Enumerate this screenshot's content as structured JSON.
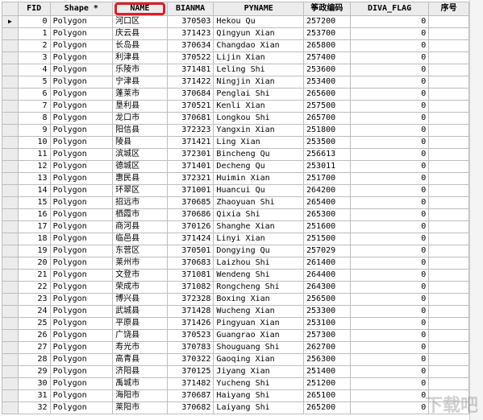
{
  "columns": [
    "FID",
    "Shape *",
    "NAME",
    "BIANMA",
    "PYNAME",
    "筝政编码",
    "DIVA_FLAG",
    "序号"
  ],
  "rows": [
    {
      "fid": "0",
      "shape": "Polygon",
      "name": "河口区",
      "bianma": "370503",
      "pyname": "Hekou Qu",
      "code": "257200",
      "flag": "0"
    },
    {
      "fid": "1",
      "shape": "Polygon",
      "name": "庆云县",
      "bianma": "371423",
      "pyname": "Qingyun Xian",
      "code": "253700",
      "flag": "0"
    },
    {
      "fid": "2",
      "shape": "Polygon",
      "name": "长岛县",
      "bianma": "370634",
      "pyname": "Changdao Xian",
      "code": "265800",
      "flag": "0"
    },
    {
      "fid": "3",
      "shape": "Polygon",
      "name": "利津县",
      "bianma": "370522",
      "pyname": "Lijin Xian",
      "code": "257400",
      "flag": "0"
    },
    {
      "fid": "4",
      "shape": "Polygon",
      "name": "乐陵市",
      "bianma": "371481",
      "pyname": "Leling Shi",
      "code": "253600",
      "flag": "0"
    },
    {
      "fid": "5",
      "shape": "Polygon",
      "name": "宁津县",
      "bianma": "371422",
      "pyname": "Ningjin Xian",
      "code": "253400",
      "flag": "0"
    },
    {
      "fid": "6",
      "shape": "Polygon",
      "name": "蓬莱市",
      "bianma": "370684",
      "pyname": "Penglai Shi",
      "code": "265600",
      "flag": "0"
    },
    {
      "fid": "7",
      "shape": "Polygon",
      "name": "垦利县",
      "bianma": "370521",
      "pyname": "Kenli Xian",
      "code": "257500",
      "flag": "0"
    },
    {
      "fid": "8",
      "shape": "Polygon",
      "name": "龙口市",
      "bianma": "370681",
      "pyname": "Longkou Shi",
      "code": "265700",
      "flag": "0"
    },
    {
      "fid": "9",
      "shape": "Polygon",
      "name": "阳信县",
      "bianma": "372323",
      "pyname": "Yangxin Xian",
      "code": "251800",
      "flag": "0"
    },
    {
      "fid": "10",
      "shape": "Polygon",
      "name": "陵县",
      "bianma": "371421",
      "pyname": "Ling Xian",
      "code": "253500",
      "flag": "0"
    },
    {
      "fid": "11",
      "shape": "Polygon",
      "name": "滨城区",
      "bianma": "372301",
      "pyname": "Bincheng Qu",
      "code": "256613",
      "flag": "0"
    },
    {
      "fid": "12",
      "shape": "Polygon",
      "name": "德城区",
      "bianma": "371401",
      "pyname": "Decheng Qu",
      "code": "253011",
      "flag": "0"
    },
    {
      "fid": "13",
      "shape": "Polygon",
      "name": "惠民县",
      "bianma": "372321",
      "pyname": "Huimin Xian",
      "code": "251700",
      "flag": "0"
    },
    {
      "fid": "14",
      "shape": "Polygon",
      "name": "环翠区",
      "bianma": "371001",
      "pyname": "Huancui Qu",
      "code": "264200",
      "flag": "0"
    },
    {
      "fid": "15",
      "shape": "Polygon",
      "name": "招远市",
      "bianma": "370685",
      "pyname": "Zhaoyuan Shi",
      "code": "265400",
      "flag": "0"
    },
    {
      "fid": "16",
      "shape": "Polygon",
      "name": "栖霞市",
      "bianma": "370686",
      "pyname": "Qixia Shi",
      "code": "265300",
      "flag": "0"
    },
    {
      "fid": "17",
      "shape": "Polygon",
      "name": "商河县",
      "bianma": "370126",
      "pyname": "Shanghe Xian",
      "code": "251600",
      "flag": "0"
    },
    {
      "fid": "18",
      "shape": "Polygon",
      "name": "临邑县",
      "bianma": "371424",
      "pyname": "Linyi Xian",
      "code": "251500",
      "flag": "0"
    },
    {
      "fid": "19",
      "shape": "Polygon",
      "name": "东营区",
      "bianma": "370501",
      "pyname": "Dongying Qu",
      "code": "257029",
      "flag": "0"
    },
    {
      "fid": "20",
      "shape": "Polygon",
      "name": "莱州市",
      "bianma": "370683",
      "pyname": "Laizhou Shi",
      "code": "261400",
      "flag": "0"
    },
    {
      "fid": "21",
      "shape": "Polygon",
      "name": "文登市",
      "bianma": "371081",
      "pyname": "Wendeng Shi",
      "code": "264400",
      "flag": "0"
    },
    {
      "fid": "22",
      "shape": "Polygon",
      "name": "荣成市",
      "bianma": "371082",
      "pyname": "Rongcheng Shi",
      "code": "264300",
      "flag": "0"
    },
    {
      "fid": "23",
      "shape": "Polygon",
      "name": "博兴县",
      "bianma": "372328",
      "pyname": "Boxing Xian",
      "code": "256500",
      "flag": "0"
    },
    {
      "fid": "24",
      "shape": "Polygon",
      "name": "武城县",
      "bianma": "371428",
      "pyname": "Wucheng Xian",
      "code": "253300",
      "flag": "0"
    },
    {
      "fid": "25",
      "shape": "Polygon",
      "name": "平原县",
      "bianma": "371426",
      "pyname": "Pingyuan Xian",
      "code": "253100",
      "flag": "0"
    },
    {
      "fid": "26",
      "shape": "Polygon",
      "name": "广饶县",
      "bianma": "370523",
      "pyname": "Guangrao Xian",
      "code": "257300",
      "flag": "0"
    },
    {
      "fid": "27",
      "shape": "Polygon",
      "name": "寿光市",
      "bianma": "370783",
      "pyname": "Shouguang Shi",
      "code": "262700",
      "flag": "0"
    },
    {
      "fid": "28",
      "shape": "Polygon",
      "name": "高青县",
      "bianma": "370322",
      "pyname": "Gaoqing Xian",
      "code": "256300",
      "flag": "0"
    },
    {
      "fid": "29",
      "shape": "Polygon",
      "name": "济阳县",
      "bianma": "370125",
      "pyname": "Jiyang Xian",
      "code": "251400",
      "flag": "0"
    },
    {
      "fid": "30",
      "shape": "Polygon",
      "name": "禹城市",
      "bianma": "371482",
      "pyname": "Yucheng Shi",
      "code": "251200",
      "flag": "0"
    },
    {
      "fid": "31",
      "shape": "Polygon",
      "name": "海阳市",
      "bianma": "370687",
      "pyname": "Haiyang Shi",
      "code": "265100",
      "flag": "0"
    },
    {
      "fid": "32",
      "shape": "Polygon",
      "name": "莱阳市",
      "bianma": "370682",
      "pyname": "Laiyang Shi",
      "code": "265200",
      "flag": "0"
    }
  ],
  "row_pointer": "▶",
  "watermark": "下载吧"
}
